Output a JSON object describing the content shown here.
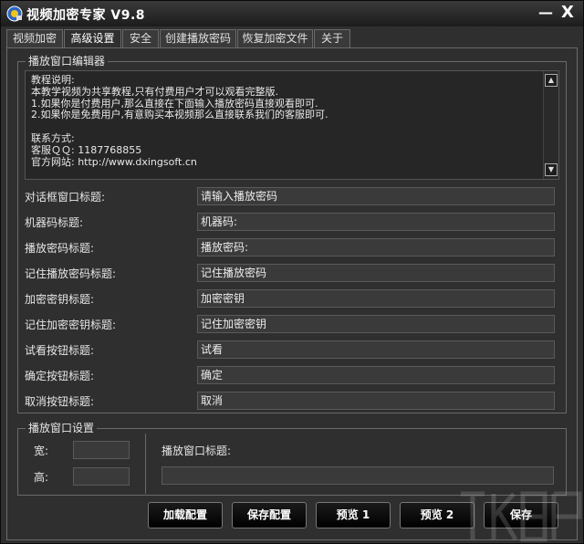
{
  "window": {
    "title": "视频加密专家 V9.8",
    "minimize_glyph": "—",
    "close_glyph": "X"
  },
  "tabs": [
    {
      "label": "视频加密",
      "active": false
    },
    {
      "label": "高级设置",
      "active": true
    },
    {
      "label": "安全",
      "active": false
    },
    {
      "label": "创建播放密码",
      "active": false
    },
    {
      "label": "恢复加密文件",
      "active": false
    },
    {
      "label": "关于",
      "active": false
    }
  ],
  "editor_group": {
    "title": "播放窗口编辑器",
    "text": "教程说明:\n本教学视频为共享教程,只有付费用户才可以观看完整版.\n1.如果你是付费用户,那么直接在下面输入播放密码直接观看即可.\n2.如果你是免费用户,有意购买本视频那么直接联系我们的客服即可.\n\n联系方式:\n客服ＱＱ: 1187768855\n官方网站: http://www.dxingsoft.cn"
  },
  "fields": [
    {
      "label": "对话框窗口标题:",
      "value": "请输入播放密码"
    },
    {
      "label": "机器码标题:",
      "value": "机器码:"
    },
    {
      "label": "播放密码标题:",
      "value": "播放密码:"
    },
    {
      "label": "记住播放密码标题:",
      "value": "记住播放密码"
    },
    {
      "label": "加密密钥标题:",
      "value": "加密密钥"
    },
    {
      "label": "记住加密密钥标题:",
      "value": "记住加密密钥"
    },
    {
      "label": "试看按钮标题:",
      "value": "试看"
    },
    {
      "label": "确定按钮标题:",
      "value": "确定"
    },
    {
      "label": "取消按钮标题:",
      "value": "取消"
    }
  ],
  "settings_group": {
    "title": "播放窗口设置",
    "width_label": "宽:",
    "width_value": "",
    "height_label": "高:",
    "height_value": "",
    "window_title_label": "播放窗口标题:",
    "window_title_value": ""
  },
  "buttons": {
    "load_config": "加载配置",
    "save_config": "保存配置",
    "preview1": "预览 1",
    "preview2": "预览 2",
    "save": "保存"
  },
  "icons": {
    "app": "video-lock-app-icon",
    "up": "scroll-up-icon",
    "down": "scroll-down-icon"
  },
  "colors": {
    "window_bg": "#2f2f2f",
    "input_bg": "#3a3a3a",
    "border": "#6a6a6a",
    "button_bg": "#000000"
  }
}
